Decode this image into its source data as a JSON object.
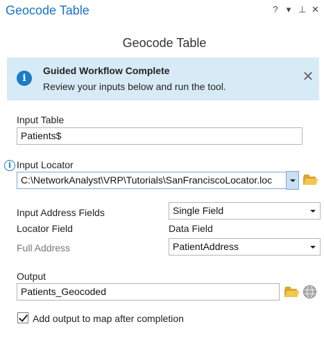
{
  "pane": {
    "title": "Geocode Table",
    "controls": {
      "help": "?",
      "menu": "▾",
      "pin": "⊥",
      "close": "✕"
    }
  },
  "tool": {
    "title": "Geocode Table"
  },
  "banner": {
    "title": "Guided Workflow Complete",
    "text": "Review your inputs below and run the tool.",
    "icon": "info-icon",
    "close": "✕"
  },
  "params": {
    "input_table": {
      "label": "Input Table",
      "value": "Patients$"
    },
    "input_locator": {
      "label": "Input Locator",
      "value": "C:\\NetworkAnalyst\\VRP\\Tutorials\\SanFranciscoLocator.loc"
    },
    "address_fields": {
      "label": "Input Address Fields",
      "value": "Single Field"
    },
    "mapping_header": {
      "locator_field": "Locator Field",
      "data_field": "Data Field"
    },
    "full_address": {
      "label": "Full Address",
      "value": "PatientAddress"
    },
    "output": {
      "label": "Output",
      "value": "Patients_Geocoded"
    },
    "add_to_map": {
      "label": "Add output to map after completion",
      "checked": true
    }
  },
  "info_glyph": "i"
}
